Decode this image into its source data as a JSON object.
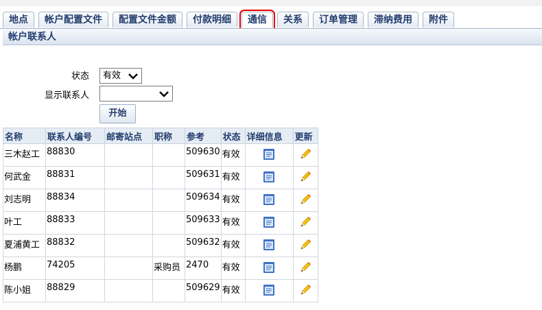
{
  "tabs": [
    {
      "label": "地点"
    },
    {
      "label": "帐户配置文件"
    },
    {
      "label": "配置文件金额"
    },
    {
      "label": "付款明细"
    },
    {
      "label": "通信",
      "active": true
    },
    {
      "label": "关系"
    },
    {
      "label": "订单管理"
    },
    {
      "label": "滞纳费用"
    },
    {
      "label": "附件"
    }
  ],
  "section_title": "帐户联系人",
  "filters": {
    "status_label": "状态",
    "status_value": "有效",
    "show_contact_label": "显示联系人",
    "show_contact_value": "",
    "go_button": "开始"
  },
  "table": {
    "headers": [
      "名称",
      "联系人编号",
      "邮寄站点",
      "职称",
      "参考",
      "状态",
      "详细信息",
      "更新"
    ],
    "rows": [
      {
        "name": "三木赵工",
        "contact_no": "88830",
        "mail_site": "",
        "title": "",
        "ref": "509630",
        "status": "有效"
      },
      {
        "name": "何武金",
        "contact_no": "88831",
        "mail_site": "",
        "title": "",
        "ref": "509631",
        "status": "有效"
      },
      {
        "name": "刘志明",
        "contact_no": "88834",
        "mail_site": "",
        "title": "",
        "ref": "509634",
        "status": "有效"
      },
      {
        "name": "叶工",
        "contact_no": "88833",
        "mail_site": "",
        "title": "",
        "ref": "509633",
        "status": "有效"
      },
      {
        "name": "夏浦黄工",
        "contact_no": "88832",
        "mail_site": "",
        "title": "",
        "ref": "509632",
        "status": "有效"
      },
      {
        "name": "杨鹏",
        "contact_no": "74205",
        "mail_site": "",
        "title": "采购员",
        "ref": "2470",
        "status": "有效"
      },
      {
        "name": "陈小姐",
        "contact_no": "88829",
        "mail_site": "",
        "title": "",
        "ref": "509629",
        "status": "有效"
      }
    ]
  },
  "icons": {
    "details": "details-page-icon",
    "update": "pencil-icon"
  },
  "colors": {
    "tab_text": "#233d6e",
    "active_tab_highlight": "#e60000"
  }
}
